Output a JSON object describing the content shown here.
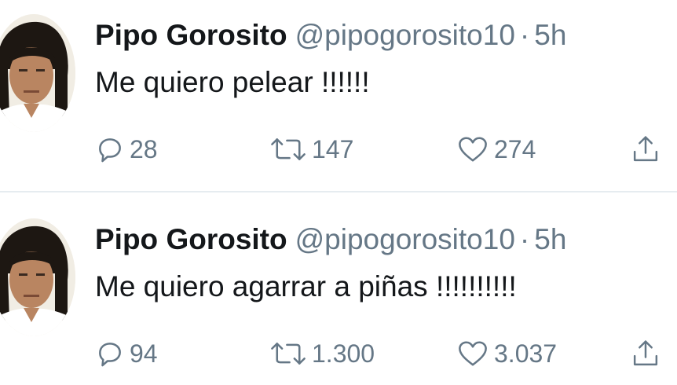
{
  "tweets": [
    {
      "name": "Pipo Gorosito",
      "handle": "@pipogorosito10",
      "separator": "·",
      "time": "5h",
      "text": "Me quiero pelear !!!!!!",
      "replies": "28",
      "retweets": "147",
      "likes": "274"
    },
    {
      "name": "Pipo Gorosito",
      "handle": "@pipogorosito10",
      "separator": "·",
      "time": "5h",
      "text": "Me quiero agarrar a piñas !!!!!!!!!!",
      "replies": "94",
      "retweets": "1.300",
      "likes": "3.037"
    }
  ],
  "icons": {
    "reply": "reply-icon",
    "retweet": "retweet-icon",
    "like": "heart-icon",
    "share": "share-icon"
  },
  "colors": {
    "text": "#14171a",
    "secondary": "#657786",
    "divider": "#e6ecf0"
  }
}
